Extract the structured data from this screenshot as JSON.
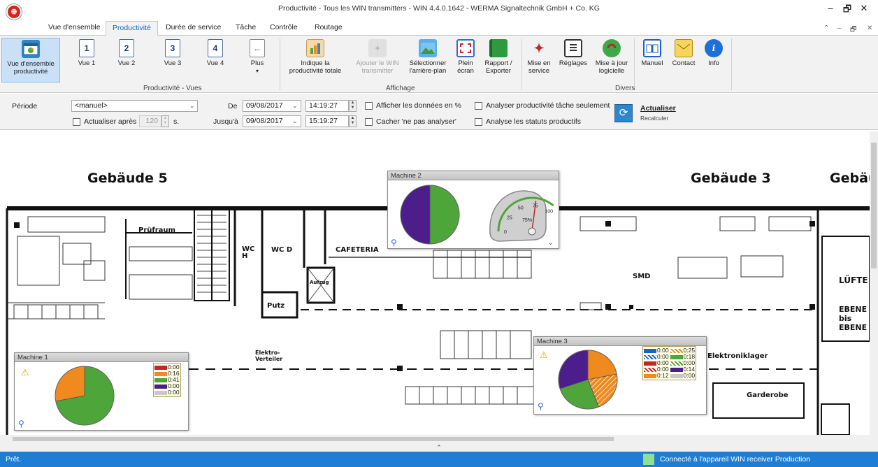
{
  "window": {
    "title": "Productivité - Tous les WIN transmitters - WIN 4.4.0.1642 - WERMA Signaltechnik GmbH + Co. KG",
    "logo_icon": "werma-logo-icon",
    "controls": {
      "minimize": "–",
      "restore": "🗗",
      "close": "✕"
    }
  },
  "tabs": [
    {
      "label": "Vue d'ensemble"
    },
    {
      "label": "Productivité"
    },
    {
      "label": "Durée de service"
    },
    {
      "label": "Tâche"
    },
    {
      "label": "Contrôle"
    },
    {
      "label": "Routage"
    }
  ],
  "ribbon": {
    "vue_ensemble": {
      "label_line1": "Vue d'ensemble",
      "label_line2": "productivité"
    },
    "vues": [
      {
        "number": "1",
        "label": "Vue 1"
      },
      {
        "number": "2",
        "label": "Vue 2"
      },
      {
        "number": "3",
        "label": "Vue 3"
      },
      {
        "number": "4",
        "label": "Vue 4"
      }
    ],
    "plus": {
      "icon_text": "...",
      "label": "Plus",
      "caret": "▾"
    },
    "group_vues": "Productivité - Vues",
    "affichage": [
      {
        "line1": "Indique la",
        "line2": "productivité totale"
      },
      {
        "line1": "Ajouter le WIN",
        "line2": "transmitter"
      },
      {
        "line1": "Sélectionner",
        "line2": "l'arrière-plan"
      },
      {
        "line1": "Plein",
        "line2": "écran"
      },
      {
        "line1": "Rapport /",
        "line2": "Exporter"
      }
    ],
    "group_affichage": "Affichage",
    "divers": [
      {
        "line1": "Mise en",
        "line2": "service"
      },
      {
        "line1": "Réglages",
        "line2": ""
      },
      {
        "line1": "Mise à jour",
        "line2": "logicielle"
      },
      {
        "line1": "Manuel",
        "line2": ""
      },
      {
        "line1": "Contact",
        "line2": ""
      },
      {
        "line1": "Info",
        "line2": ""
      }
    ],
    "group_divers": "Divers"
  },
  "filters": {
    "periode_label": "Période",
    "periode_value": "<manuel>",
    "actualiser_apres_label": "Actualiser après",
    "actualiser_apres_value": "120",
    "actualiser_apres_unit": "s.",
    "de_label": "De",
    "de_date": "09/08/2017",
    "de_time": "14:19:27",
    "jusqua_label": "Jusqu'à",
    "jusqua_date": "09/08/2017",
    "jusqua_time": "15:19:27",
    "afficher_pct": "Afficher les données en %",
    "cacher": "Cacher 'ne pas analyser'",
    "analyser_tache": "Analyser productivité tâche seulement",
    "analyse_statuts": "Analyse les statuts productifs",
    "actualiser_label": "Actualiser",
    "recalculer_label": "Recalculer"
  },
  "floorplan": {
    "building_left": "Gebäude 5",
    "building_right": "Gebäude 3",
    "building_far_right": "Gebäu",
    "rooms": [
      "Prüfraum",
      "WC H",
      "WC D",
      "CAFETERIA",
      "Putz",
      "Aufzug",
      "Elektro-Verteiler",
      "SMD",
      "Elektroniklager",
      "Garderobe",
      "LÜFTE",
      "EBENE bis EBENE"
    ]
  },
  "machines": [
    {
      "title": "Machine 1",
      "warning": true,
      "pie": [
        {
          "color": "#4ea53a",
          "fraction": 0.72,
          "pattern": false
        },
        {
          "color": "#f0891e",
          "fraction": 0.28,
          "pattern": false
        }
      ],
      "legend": [
        {
          "color": "#c0262c",
          "value": "0:00"
        },
        {
          "color": "#f0891e",
          "value": "0:16"
        },
        {
          "color": "#4ea53a",
          "value": "0:41"
        },
        {
          "color": "#4b1e8c",
          "value": "0:00"
        },
        {
          "color": "#c8c8c8",
          "value": "0:00"
        }
      ]
    },
    {
      "title": "Machine 2",
      "warning": false,
      "pie": [
        {
          "color": "#4ea53a",
          "fraction": 0.5,
          "pattern": false
        },
        {
          "color": "#4b1e8c",
          "fraction": 0.5,
          "pattern": false
        }
      ],
      "gauge": {
        "ticks": [
          "0",
          "25",
          "50",
          "75",
          "100"
        ],
        "value_label": "75%",
        "value": 75
      },
      "legend": []
    },
    {
      "title": "Machine 3",
      "warning": true,
      "pie": [
        {
          "color": "#f0891e",
          "fraction": 0.22,
          "pattern": false
        },
        {
          "color": "#f0891e",
          "fraction": 0.22,
          "pattern": true
        },
        {
          "color": "#4ea53a",
          "fraction": 0.26,
          "pattern": false
        },
        {
          "color": "#4b1e8c",
          "fraction": 0.3,
          "pattern": false
        }
      ],
      "legend_left": [
        {
          "color": "#1e5fc8",
          "value": "0:00",
          "pattern": false
        },
        {
          "color": "#1e5fc8",
          "value": "0:00",
          "pattern": true
        },
        {
          "color": "#c0262c",
          "value": "0:00",
          "pattern": false
        },
        {
          "color": "#c0262c",
          "value": "0:00",
          "pattern": true
        },
        {
          "color": "#f0891e",
          "value": "0:12",
          "pattern": false
        }
      ],
      "legend_right": [
        {
          "color": "#f0891e",
          "value": "0:25",
          "pattern": true
        },
        {
          "color": "#4ea53a",
          "value": "0:18",
          "pattern": false
        },
        {
          "color": "#4ea53a",
          "value": "0:00",
          "pattern": true
        },
        {
          "color": "#4b1e8c",
          "value": "0:14",
          "pattern": false
        },
        {
          "color": "#c8c8c8",
          "value": "0:00",
          "pattern": false
        }
      ]
    }
  ],
  "statusbar": {
    "left": "Prêt.",
    "right": "Connecté à l'appareil WIN receiver Production"
  },
  "colors": {
    "accent": "#1e7ed6",
    "selected": "#c9e0f7"
  }
}
